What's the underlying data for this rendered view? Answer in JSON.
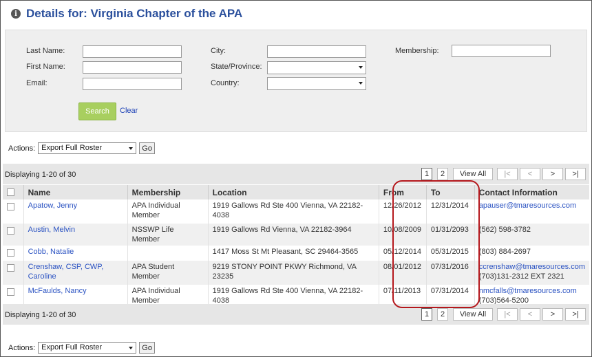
{
  "title": "Details for: Virginia Chapter of the APA",
  "search": {
    "last_name_label": "Last Name:",
    "first_name_label": "First Name:",
    "email_label": "Email:",
    "city_label": "City:",
    "state_label": "State/Province:",
    "country_label": "Country:",
    "membership_label": "Membership:",
    "search_button": "Search",
    "clear_link": "Clear"
  },
  "actions": {
    "label": "Actions:",
    "selected": "Export Full Roster",
    "go": "Go"
  },
  "pager": {
    "display_text": "Displaying 1-20 of 30",
    "pages": [
      "1",
      "2"
    ],
    "view_all": "View All",
    "first": "|<",
    "prev": "<",
    "next": ">",
    "last": ">|"
  },
  "table": {
    "headers": [
      "Name",
      "Membership",
      "Location",
      "From",
      "To",
      "Contact Information"
    ],
    "rows": [
      {
        "name": "Apatow, Jenny",
        "membership": "APA Individual Member",
        "location": "1919 Gallows Rd Ste 400 Vienna, VA   22182-4038",
        "from": "12/26/2012",
        "to": "12/31/2014",
        "contact1": "apauser@tmaresources.com",
        "contact2": ""
      },
      {
        "name": "Austin, Melvin",
        "membership": "NSSWP Life Member",
        "location": "1919 Gallows Rd Vienna, VA 22182-3964",
        "from": "10/08/2009",
        "to": "01/31/2093",
        "contact1": "",
        "contact2": "(562) 598-3782"
      },
      {
        "name": "Cobb, Natalie",
        "membership": "",
        "location": "1417 Moss St Mt Pleasant, SC 29464-3565",
        "from": "05/12/2014",
        "to": "05/31/2015",
        "contact1": "",
        "contact2": "(803) 884-2697"
      },
      {
        "name": "Crenshaw, CSP, CWP, Caroline",
        "membership": "APA Student Member",
        "location": "9219 STONY POINT PKWY Richmond, VA   23235",
        "from": "08/01/2012",
        "to": "07/31/2016",
        "contact1": "ccrenshaw@tmaresources.com",
        "contact2": "(703)131-2312 EXT 2321"
      },
      {
        "name": "McFaulds, Nancy",
        "membership": "APA Individual Member",
        "location": "1919 Gallows Rd Ste 400 Vienna, VA   22182-4038",
        "from": "07/11/2013",
        "to": "07/31/2014",
        "contact1": "nmcfalls@tmaresources.com",
        "contact2": "(703)564-5200"
      }
    ]
  },
  "colors": {
    "title": "#2a4f9c",
    "link": "#2a52c2",
    "search_button": "#a8cf5f",
    "highlight": "#b5171c"
  }
}
